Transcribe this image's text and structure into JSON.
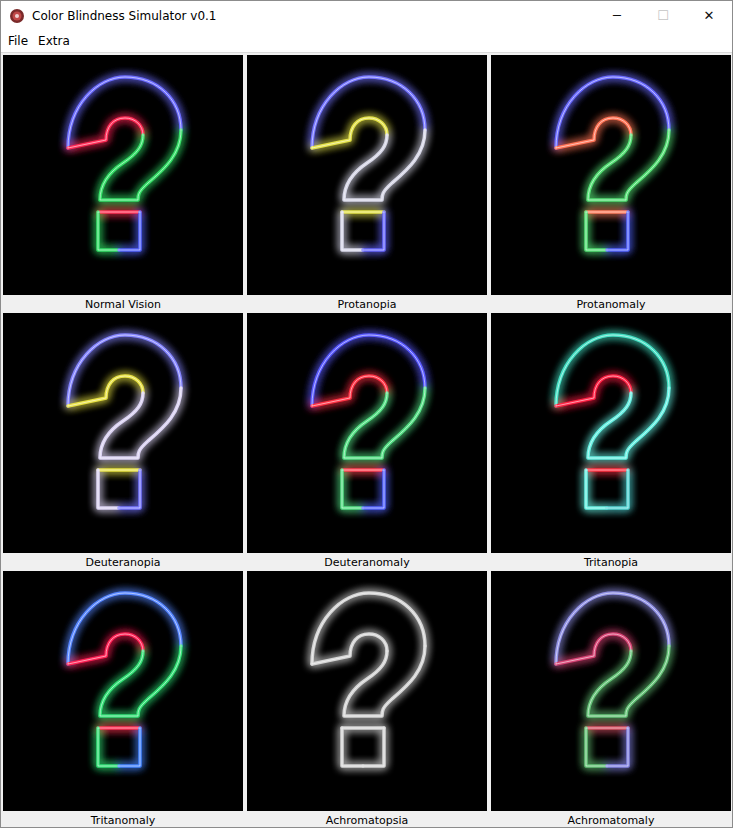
{
  "window": {
    "title": "Color Blindness Simulator v0.1",
    "controls": [
      {
        "label": "─",
        "disabled": false
      },
      {
        "label": "☐",
        "disabled": true
      },
      {
        "label": "✕",
        "disabled": false
      }
    ]
  },
  "menu": [
    "File",
    "Extra"
  ],
  "panels": [
    {
      "label": "Normal Vision",
      "colors": {
        "arc": "#6c6cff",
        "hook": "#ff2a55",
        "stem": "#35e068",
        "box_top": "#ff3355",
        "box_left": "#35e068",
        "box_right": "#5565ff"
      }
    },
    {
      "label": "Protanopia",
      "colors": {
        "arc": "#7474ff",
        "hook": "#e4e248",
        "stem": "#d6d6e6",
        "box_top": "#e4e248",
        "box_left": "#d8d8ea",
        "box_right": "#6868ff"
      }
    },
    {
      "label": "Protanomaly",
      "colors": {
        "arc": "#6a6aff",
        "hook": "#ff7355",
        "stem": "#55e075",
        "box_top": "#ff8060",
        "box_left": "#55e075",
        "box_right": "#5565ff"
      }
    },
    {
      "label": "Deuteranopia",
      "colors": {
        "arc": "#8585ff",
        "hook": "#e8e244",
        "stem": "#dad2f2",
        "box_top": "#e8e244",
        "box_left": "#dad2f2",
        "box_right": "#7575ff"
      }
    },
    {
      "label": "Deuteranomaly",
      "colors": {
        "arc": "#5a5aff",
        "hook": "#ff3344",
        "stem": "#55e085",
        "box_top": "#ff4455",
        "box_left": "#55e085",
        "box_right": "#5565ff"
      }
    },
    {
      "label": "Tritanopia",
      "colors": {
        "arc": "#44e0c4",
        "hook": "#ff2244",
        "stem": "#66f0e2",
        "box_top": "#ff3344",
        "box_left": "#66f0e2",
        "box_right": "#55d4d4"
      }
    },
    {
      "label": "Tritanomaly",
      "colors": {
        "arc": "#5585ff",
        "hook": "#ff2255",
        "stem": "#33e075",
        "box_top": "#ff3355",
        "box_left": "#33e075",
        "box_right": "#4585ff"
      }
    },
    {
      "label": "Achromatopsia",
      "colors": {
        "arc": "#d4d4d4",
        "hook": "#d4d4d4",
        "stem": "#d4d4d4",
        "box_top": "#d4d4d4",
        "box_left": "#d4d4d4",
        "box_right": "#d4d4d4"
      }
    },
    {
      "label": "Achromatomaly",
      "colors": {
        "arc": "#9090e4",
        "hook": "#d84475",
        "stem": "#66c478",
        "box_top": "#d85566",
        "box_left": "#66c478",
        "box_right": "#8585e4"
      }
    }
  ]
}
